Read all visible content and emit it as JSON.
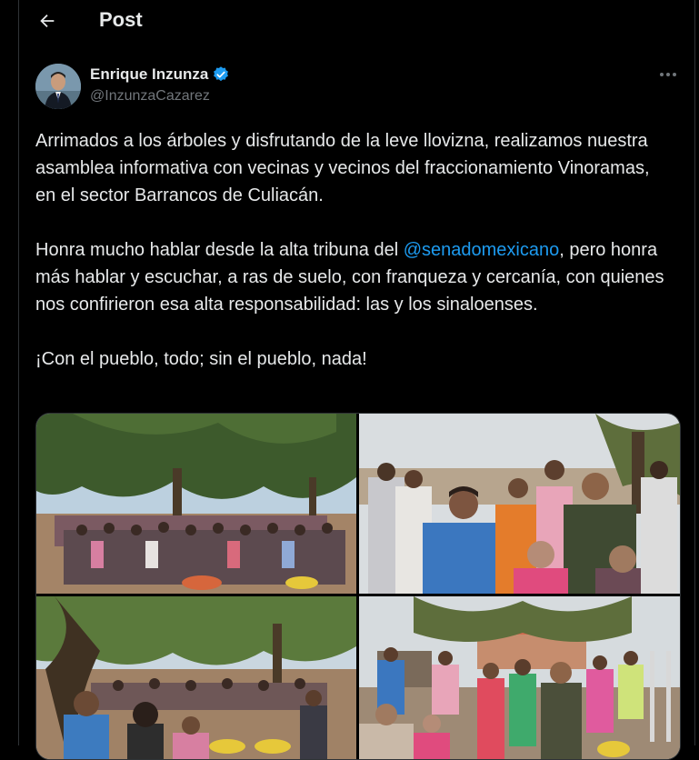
{
  "header": {
    "title": "Post"
  },
  "author": {
    "name": "Enrique Inzunza",
    "handle": "@InzunzaCazarez"
  },
  "tweet": {
    "p1": "Arrimados  a los árboles y disfrutando de la leve llovizna, realizamos nuestra asamblea informativa con vecinas y vecinos del fraccionamiento Vinoramas, en el sector Barrancos de Culiacán.",
    "p2_before": "Honra mucho hablar desde la alta tribuna del ",
    "p2_mention": "@senadomexicano",
    "p2_after": ", pero honra más hablar y escuchar, a ras de suelo, con franqueza y cercanía, con quienes nos confirieron esa alta responsabilidad: las y los sinaloenses.",
    "p3": "¡Con el pueblo, todo; sin el pueblo, nada!"
  },
  "colors": {
    "accent": "#1d9bf0",
    "background": "#000000",
    "text": "#e7e9ea",
    "muted": "#71767b"
  },
  "icons": [
    "back-arrow-icon",
    "verified-badge-icon",
    "more-options-icon"
  ]
}
